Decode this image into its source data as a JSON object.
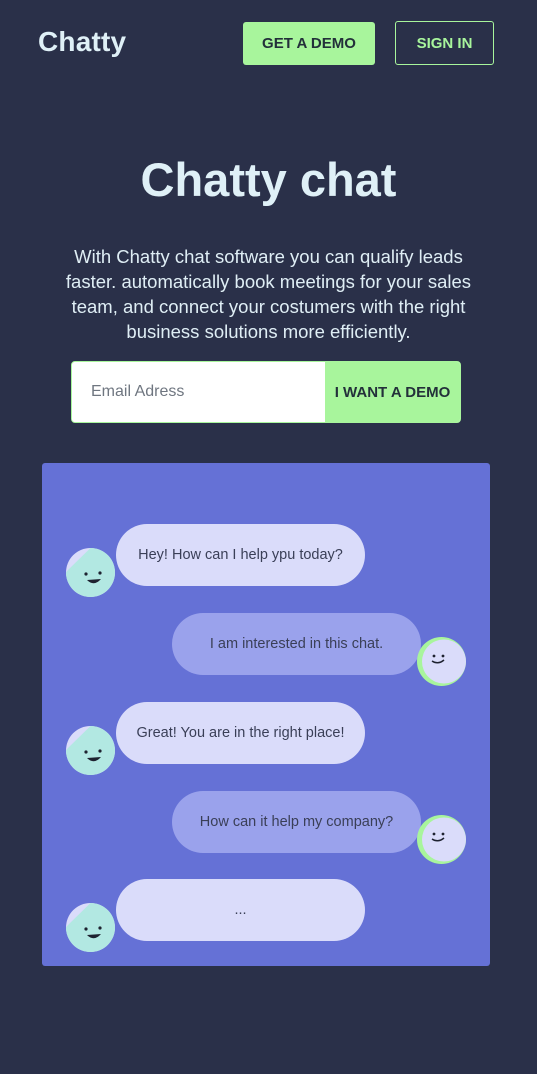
{
  "header": {
    "brand": "Chatty",
    "demo_button": "GET A DEMO",
    "signin_button": "SIGN IN"
  },
  "hero": {
    "title": "Chatty chat",
    "subtitle": "With Chatty chat software you can qualify leads faster. automatically book meetings for your sales team, and connect your costumers with the right business solutions more efficiently."
  },
  "form": {
    "email_placeholder": "Email Adress",
    "email_value": "",
    "submit_label": "I WANT A DEMO"
  },
  "chat": {
    "messages": [
      {
        "sender": "bot",
        "text": "Hey! How can I help ypu today?"
      },
      {
        "sender": "user",
        "text": "I am interested in this chat."
      },
      {
        "sender": "bot",
        "text": "Great! You are in the right place!"
      },
      {
        "sender": "user",
        "text": "How can it help my company?"
      },
      {
        "sender": "bot",
        "text": "..."
      }
    ]
  },
  "colors": {
    "background": "#2a3049",
    "accent": "#a8f59c",
    "chat_panel": "#6571d6",
    "bot_bubble": "#dadcfa",
    "user_bubble": "#9aa2ec",
    "bot_avatar": "#b2e8e2",
    "user_avatar": "#dadcfa"
  },
  "icons": {
    "bot_avatar": "bot-smiley-avatar-icon",
    "user_avatar": "user-smiley-avatar-icon"
  }
}
